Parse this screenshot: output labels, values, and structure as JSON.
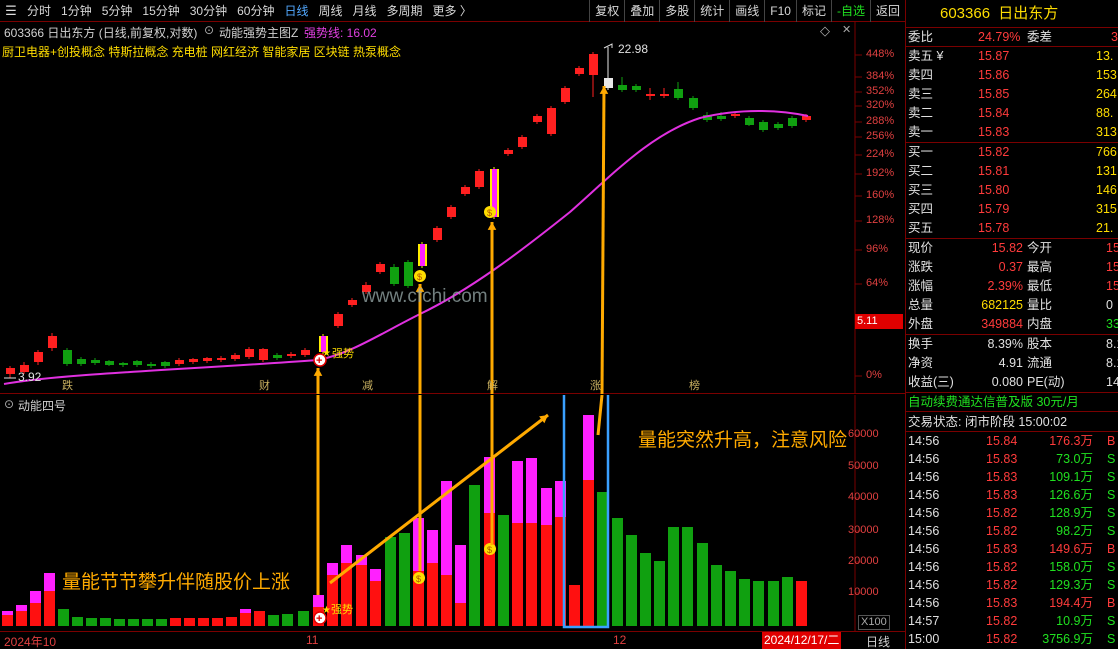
{
  "toolbar": {
    "left_items": [
      "分时",
      "1分钟",
      "5分钟",
      "15分钟",
      "30分钟",
      "60分钟",
      "日线",
      "周线",
      "月线",
      "多周期",
      "更多 〉"
    ],
    "active_item": "日线",
    "right_items": [
      "复权",
      "叠加",
      "多股",
      "统计",
      "画线",
      "F10",
      "标记",
      "-自选",
      "返回"
    ]
  },
  "chart_header": {
    "stock_info": "603366 日出东方 (日线,前复权,对数)",
    "indicator_name": "动能强势主图Z",
    "indicator_value_label": "强势线: 16.02",
    "concepts": "厨卫电器+创投概念 特斯拉概念 充电桩 网红经济 智能家居 区块链 热泵概念"
  },
  "price_axis": [
    "448%",
    "384%",
    "352%",
    "320%",
    "288%",
    "256%",
    "224%",
    "192%",
    "160%",
    "128%",
    "96%",
    "64%",
    "0%"
  ],
  "current_price_tag": "5.11",
  "annotations": {
    "high": "22.98",
    "low": "3.92",
    "strong_label": "强势",
    "watermark": "www.cfchi.com",
    "event_marks": [
      "跌",
      "财",
      "减",
      "解",
      "涨",
      "榜"
    ],
    "vol_text_left": "量能节节攀升伴随股价上涨",
    "vol_text_right": "量能突然升高，注意风险"
  },
  "vol_panel": {
    "title": "动能四号",
    "axis": [
      "60000",
      "50000",
      "40000",
      "30000",
      "20000",
      "10000"
    ],
    "scale_tag": "X100"
  },
  "time_axis": {
    "labels": [
      "2024年10",
      "11",
      "12"
    ],
    "current_date": "2024/12/17/二",
    "period": "日线"
  },
  "chart_data": {
    "type": "candlestick",
    "price_low": 3.92,
    "price_high": 22.98,
    "strength_line_value": 16.02
  },
  "quote": {
    "code": "603366",
    "name": "日出东方",
    "weibi_label": "委比",
    "weibi_value": "24.79%",
    "weicha_label": "委差",
    "weicha_value": "3",
    "asks": [
      {
        "label": "卖五 ¥",
        "price": "15.87",
        "vol": "13."
      },
      {
        "label": "卖四",
        "price": "15.86",
        "vol": "153"
      },
      {
        "label": "卖三",
        "price": "15.85",
        "vol": "264"
      },
      {
        "label": "卖二",
        "price": "15.84",
        "vol": "88."
      },
      {
        "label": "卖一",
        "price": "15.83",
        "vol": "313"
      }
    ],
    "bids": [
      {
        "label": "买一",
        "price": "15.82",
        "vol": "766"
      },
      {
        "label": "买二",
        "price": "15.81",
        "vol": "131"
      },
      {
        "label": "买三",
        "price": "15.80",
        "vol": "146"
      },
      {
        "label": "买四",
        "price": "15.79",
        "vol": "315"
      },
      {
        "label": "买五",
        "price": "15.78",
        "vol": "21."
      }
    ],
    "stats1": [
      {
        "l1": "现价",
        "v1": "15.82",
        "l2": "今开",
        "v2": "15"
      },
      {
        "l1": "涨跌",
        "v1": "0.37",
        "l2": "最高",
        "v2": "15"
      },
      {
        "l1": "涨幅",
        "v1": "2.39%",
        "l2": "最低",
        "v2": "15"
      },
      {
        "l1": "总量",
        "v1": "682125",
        "l2": "量比",
        "v2": "0"
      },
      {
        "l1": "外盘",
        "v1": "349884",
        "l2": "内盘",
        "v2": "332"
      }
    ],
    "stats2": [
      {
        "l1": "换手",
        "v1": "8.39%",
        "l2": "股本",
        "v2": "8.1"
      },
      {
        "l1": "净资",
        "v1": "4.91",
        "l2": "流通",
        "v2": "8.1"
      },
      {
        "l1": "收益(三)",
        "v1": "0.080",
        "l2": "PE(动)",
        "v2": "14"
      }
    ],
    "promo": "自动续费通达信普及版  30元/月",
    "status": "交易状态: 闭市阶段 15:00:02",
    "trades": [
      {
        "time": "14:56",
        "price": "15.84",
        "vol": "176.3万",
        "side": "B"
      },
      {
        "time": "14:56",
        "price": "15.83",
        "vol": "73.0万",
        "side": "S"
      },
      {
        "time": "14:56",
        "price": "15.83",
        "vol": "109.1万",
        "side": "S"
      },
      {
        "time": "14:56",
        "price": "15.83",
        "vol": "126.6万",
        "side": "S"
      },
      {
        "time": "14:56",
        "price": "15.82",
        "vol": "128.9万",
        "side": "S"
      },
      {
        "time": "14:56",
        "price": "15.82",
        "vol": "98.2万",
        "side": "S"
      },
      {
        "time": "14:56",
        "price": "15.83",
        "vol": "149.6万",
        "side": "B"
      },
      {
        "time": "14:56",
        "price": "15.82",
        "vol": "158.0万",
        "side": "S"
      },
      {
        "time": "14:56",
        "price": "15.82",
        "vol": "129.3万",
        "side": "S"
      },
      {
        "time": "14:56",
        "price": "15.83",
        "vol": "194.4万",
        "side": "B"
      },
      {
        "time": "14:57",
        "price": "15.82",
        "vol": "10.9万",
        "side": "S"
      },
      {
        "time": "15:00",
        "price": "15.82",
        "vol": "3756.9万",
        "side": "S"
      }
    ]
  }
}
